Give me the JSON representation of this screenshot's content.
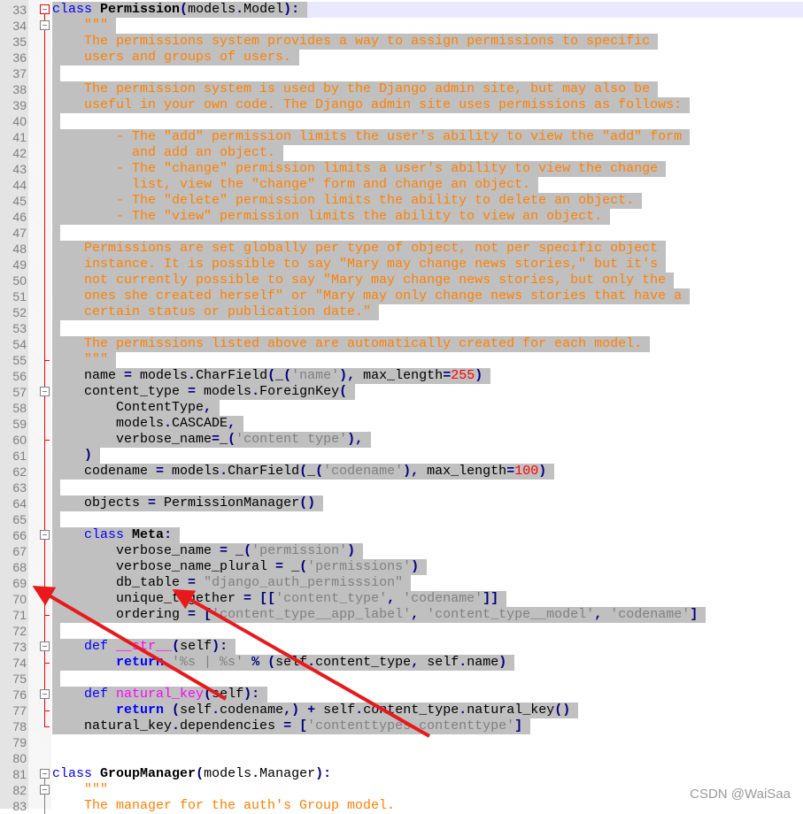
{
  "editor": {
    "current_line": 33,
    "selection": {
      "from_line": 33,
      "to_line": 78
    },
    "colors": {
      "keyword": "#0000ff",
      "docstring": "#ff8000",
      "string": "#808080",
      "number": "#ff0000",
      "operator": "#000080",
      "function": "#ff00ff",
      "selection": "#c0c0c0",
      "fold_marker": "#ff0000",
      "annotation_arrow": "#e8191b"
    },
    "lines": [
      {
        "n": "33",
        "fold": "open-red",
        "tk": [
          [
            "k",
            "class"
          ],
          [
            "t",
            " "
          ],
          [
            "c",
            "Permission"
          ],
          [
            "o",
            "("
          ],
          [
            "t",
            "models"
          ],
          [
            "o",
            "."
          ],
          [
            "t",
            "Model"
          ],
          [
            "o",
            "):"
          ]
        ]
      },
      {
        "n": "34",
        "fold": "open",
        "tk": [
          [
            "d",
            "    \"\"\""
          ]
        ]
      },
      {
        "n": "35",
        "fold": "line",
        "tk": [
          [
            "d",
            "    The permissions system provides a way to assign permissions to specific"
          ]
        ]
      },
      {
        "n": "36",
        "fold": "line",
        "tk": [
          [
            "d",
            "    users and groups of users."
          ]
        ]
      },
      {
        "n": "37",
        "fold": "line",
        "tk": []
      },
      {
        "n": "38",
        "fold": "line",
        "tk": [
          [
            "d",
            "    The permission system is used by the Django admin site, but may also be"
          ]
        ]
      },
      {
        "n": "39",
        "fold": "line",
        "tk": [
          [
            "d",
            "    useful in your own code. The Django admin site uses permissions as follows:"
          ]
        ]
      },
      {
        "n": "40",
        "fold": "line",
        "tk": []
      },
      {
        "n": "41",
        "fold": "line",
        "tk": [
          [
            "d",
            "        - The \"add\" permission limits the user's ability to view the \"add\" form"
          ]
        ]
      },
      {
        "n": "42",
        "fold": "line",
        "tk": [
          [
            "d",
            "          and add an object."
          ]
        ]
      },
      {
        "n": "43",
        "fold": "line",
        "tk": [
          [
            "d",
            "        - The \"change\" permission limits a user's ability to view the change"
          ]
        ]
      },
      {
        "n": "44",
        "fold": "line",
        "tk": [
          [
            "d",
            "          list, view the \"change\" form and change an object."
          ]
        ]
      },
      {
        "n": "45",
        "fold": "line",
        "tk": [
          [
            "d",
            "        - The \"delete\" permission limits the ability to delete an object."
          ]
        ]
      },
      {
        "n": "46",
        "fold": "line",
        "tk": [
          [
            "d",
            "        - The \"view\" permission limits the ability to view an object."
          ]
        ]
      },
      {
        "n": "47",
        "fold": "line",
        "tk": []
      },
      {
        "n": "48",
        "fold": "line",
        "tk": [
          [
            "d",
            "    Permissions are set globally per type of object, not per specific object"
          ]
        ]
      },
      {
        "n": "49",
        "fold": "line",
        "tk": [
          [
            "d",
            "    instance. It is possible to say \"Mary may change news stories,\" but it's"
          ]
        ]
      },
      {
        "n": "50",
        "fold": "line",
        "tk": [
          [
            "d",
            "    not currently possible to say \"Mary may change news stories, but only the"
          ]
        ]
      },
      {
        "n": "51",
        "fold": "line",
        "tk": [
          [
            "d",
            "    ones she created herself\" or \"Mary may only change news stories that have a"
          ]
        ]
      },
      {
        "n": "52",
        "fold": "line",
        "tk": [
          [
            "d",
            "    certain status or publication date.\""
          ]
        ]
      },
      {
        "n": "53",
        "fold": "line",
        "tk": []
      },
      {
        "n": "54",
        "fold": "line",
        "tk": [
          [
            "d",
            "    The permissions listed above are automatically created for each model."
          ]
        ]
      },
      {
        "n": "55",
        "fold": "tick",
        "tk": [
          [
            "d",
            "    \"\"\""
          ]
        ]
      },
      {
        "n": "56",
        "fold": "line",
        "tk": [
          [
            "t",
            "    name "
          ],
          [
            "o",
            "="
          ],
          [
            "t",
            " models"
          ],
          [
            "o",
            "."
          ],
          [
            "t",
            "CharField"
          ],
          [
            "o",
            "("
          ],
          [
            "t",
            "_"
          ],
          [
            "o",
            "("
          ],
          [
            "s",
            "'name'"
          ],
          [
            "o",
            "),"
          ],
          [
            "t",
            " max_length"
          ],
          [
            "o",
            "="
          ],
          [
            "n",
            "255"
          ],
          [
            "o",
            ")"
          ]
        ]
      },
      {
        "n": "57",
        "fold": "open",
        "tk": [
          [
            "t",
            "    content_type "
          ],
          [
            "o",
            "="
          ],
          [
            "t",
            " models"
          ],
          [
            "o",
            "."
          ],
          [
            "t",
            "ForeignKey"
          ],
          [
            "o",
            "("
          ]
        ]
      },
      {
        "n": "58",
        "fold": "line",
        "tk": [
          [
            "t",
            "        ContentType"
          ],
          [
            "o",
            ","
          ]
        ]
      },
      {
        "n": "59",
        "fold": "line",
        "tk": [
          [
            "t",
            "        models"
          ],
          [
            "o",
            "."
          ],
          [
            "t",
            "CASCADE"
          ],
          [
            "o",
            ","
          ]
        ]
      },
      {
        "n": "60",
        "fold": "tick",
        "tk": [
          [
            "t",
            "        verbose_name"
          ],
          [
            "o",
            "="
          ],
          [
            "t",
            "_"
          ],
          [
            "o",
            "("
          ],
          [
            "s",
            "'content type'"
          ],
          [
            "o",
            "),"
          ]
        ]
      },
      {
        "n": "61",
        "fold": "line",
        "tk": [
          [
            "o",
            "    )"
          ]
        ]
      },
      {
        "n": "62",
        "fold": "line",
        "tk": [
          [
            "t",
            "    codename "
          ],
          [
            "o",
            "="
          ],
          [
            "t",
            " models"
          ],
          [
            "o",
            "."
          ],
          [
            "t",
            "CharField"
          ],
          [
            "o",
            "("
          ],
          [
            "t",
            "_"
          ],
          [
            "o",
            "("
          ],
          [
            "s",
            "'codename'"
          ],
          [
            "o",
            "),"
          ],
          [
            "t",
            " max_length"
          ],
          [
            "o",
            "="
          ],
          [
            "n",
            "100"
          ],
          [
            "o",
            ")"
          ]
        ]
      },
      {
        "n": "63",
        "fold": "line",
        "tk": []
      },
      {
        "n": "64",
        "fold": "line",
        "tk": [
          [
            "t",
            "    objects "
          ],
          [
            "o",
            "="
          ],
          [
            "t",
            " PermissionManager"
          ],
          [
            "o",
            "()"
          ]
        ]
      },
      {
        "n": "65",
        "fold": "line",
        "tk": []
      },
      {
        "n": "66",
        "fold": "open",
        "tk": [
          [
            "t",
            "    "
          ],
          [
            "k",
            "class"
          ],
          [
            "t",
            " "
          ],
          [
            "c",
            "Meta"
          ],
          [
            "o",
            ":"
          ]
        ]
      },
      {
        "n": "67",
        "fold": "line",
        "tk": [
          [
            "t",
            "        verbose_name "
          ],
          [
            "o",
            "="
          ],
          [
            "t",
            " _"
          ],
          [
            "o",
            "("
          ],
          [
            "s",
            "'permission'"
          ],
          [
            "o",
            ")"
          ]
        ]
      },
      {
        "n": "68",
        "fold": "line",
        "tk": [
          [
            "t",
            "        verbose_name_plural "
          ],
          [
            "o",
            "="
          ],
          [
            "t",
            " _"
          ],
          [
            "o",
            "("
          ],
          [
            "s",
            "'permissions'"
          ],
          [
            "o",
            ")"
          ]
        ]
      },
      {
        "n": "69",
        "fold": "line",
        "tk": [
          [
            "t",
            "        db_table "
          ],
          [
            "o",
            "="
          ],
          [
            "t",
            " "
          ],
          [
            "s",
            "\"django_auth_permisssion\""
          ]
        ]
      },
      {
        "n": "70",
        "fold": "line",
        "tk": [
          [
            "t",
            "        unique_together "
          ],
          [
            "o",
            "="
          ],
          [
            "t",
            " "
          ],
          [
            "o",
            "[["
          ],
          [
            "s",
            "'content_type'"
          ],
          [
            "o",
            ","
          ],
          [
            "t",
            " "
          ],
          [
            "s",
            "'codename'"
          ],
          [
            "o",
            "]]"
          ]
        ]
      },
      {
        "n": "71",
        "fold": "tick",
        "tk": [
          [
            "t",
            "        ordering "
          ],
          [
            "o",
            "="
          ],
          [
            "t",
            " "
          ],
          [
            "o",
            "["
          ],
          [
            "s",
            "'content_type__app_label'"
          ],
          [
            "o",
            ","
          ],
          [
            "t",
            " "
          ],
          [
            "s",
            "'content_type__model'"
          ],
          [
            "o",
            ","
          ],
          [
            "t",
            " "
          ],
          [
            "s",
            "'codename'"
          ],
          [
            "o",
            "]"
          ]
        ]
      },
      {
        "n": "72",
        "fold": "line",
        "tk": []
      },
      {
        "n": "73",
        "fold": "open",
        "tk": [
          [
            "t",
            "    "
          ],
          [
            "k",
            "def"
          ],
          [
            "t",
            " "
          ],
          [
            "f",
            "__str__"
          ],
          [
            "o",
            "("
          ],
          [
            "t",
            "self"
          ],
          [
            "o",
            "):"
          ]
        ]
      },
      {
        "n": "74",
        "fold": "tick",
        "tk": [
          [
            "t",
            "        "
          ],
          [
            "kb",
            "return"
          ],
          [
            "t",
            " "
          ],
          [
            "s",
            "'%s | %s'"
          ],
          [
            "t",
            " "
          ],
          [
            "o",
            "%"
          ],
          [
            "t",
            " "
          ],
          [
            "o",
            "("
          ],
          [
            "t",
            "self"
          ],
          [
            "o",
            "."
          ],
          [
            "t",
            "content_type"
          ],
          [
            "o",
            ","
          ],
          [
            "t",
            " self"
          ],
          [
            "o",
            "."
          ],
          [
            "t",
            "name"
          ],
          [
            "o",
            ")"
          ]
        ]
      },
      {
        "n": "75",
        "fold": "line",
        "tk": []
      },
      {
        "n": "76",
        "fold": "open",
        "tk": [
          [
            "t",
            "    "
          ],
          [
            "k",
            "def"
          ],
          [
            "t",
            " "
          ],
          [
            "f",
            "natural_key"
          ],
          [
            "o",
            "("
          ],
          [
            "t",
            "self"
          ],
          [
            "o",
            "):"
          ]
        ]
      },
      {
        "n": "77",
        "fold": "tick",
        "tk": [
          [
            "t",
            "        "
          ],
          [
            "kb",
            "return"
          ],
          [
            "t",
            " "
          ],
          [
            "o",
            "("
          ],
          [
            "t",
            "self"
          ],
          [
            "o",
            "."
          ],
          [
            "t",
            "codename"
          ],
          [
            "o",
            ",)"
          ],
          [
            "t",
            " "
          ],
          [
            "o",
            "+"
          ],
          [
            "t",
            " self"
          ],
          [
            "o",
            "."
          ],
          [
            "t",
            "content_type"
          ],
          [
            "o",
            "."
          ],
          [
            "t",
            "natural_key"
          ],
          [
            "o",
            "()"
          ]
        ]
      },
      {
        "n": "78",
        "fold": "end",
        "tk": [
          [
            "t",
            "    natural_key"
          ],
          [
            "o",
            "."
          ],
          [
            "t",
            "dependencies "
          ],
          [
            "o",
            "="
          ],
          [
            "t",
            " "
          ],
          [
            "o",
            "["
          ],
          [
            "s",
            "'contenttypes.contenttype'"
          ],
          [
            "o",
            "]"
          ]
        ]
      },
      {
        "n": "79",
        "fold": "none",
        "tk": []
      },
      {
        "n": "80",
        "fold": "none",
        "tk": []
      },
      {
        "n": "81",
        "fold": "open",
        "tk": [
          [
            "k",
            "class"
          ],
          [
            "t",
            " "
          ],
          [
            "c",
            "GroupManager"
          ],
          [
            "o",
            "("
          ],
          [
            "t",
            "models"
          ],
          [
            "o",
            "."
          ],
          [
            "t",
            "Manager"
          ],
          [
            "o",
            "):"
          ]
        ]
      },
      {
        "n": "82",
        "fold": "open",
        "tk": [
          [
            "d",
            "    \"\"\""
          ]
        ]
      },
      {
        "n": "83",
        "fold": "gray",
        "tk": [
          [
            "d",
            "    The manager for the auth's Group model."
          ]
        ]
      }
    ]
  },
  "watermark": "CSDN @WaiSaa"
}
